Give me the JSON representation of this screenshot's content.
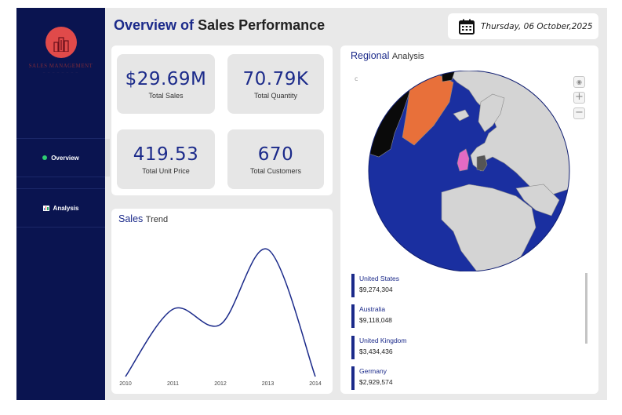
{
  "header": {
    "title_part1": "Overview of",
    "title_part2": "Sales Performance",
    "date": "Thursday, 06 October,2025"
  },
  "sidebar": {
    "logo_text": "SALES MANAGEMENT",
    "items": [
      {
        "label": "Overview",
        "icon": "green-dot-icon",
        "active": true
      },
      {
        "label": "Analysis",
        "icon": "bar-chart-icon",
        "active": false
      }
    ]
  },
  "kpis": [
    {
      "value": "$29.69M",
      "label": "Total Sales"
    },
    {
      "value": "70.79K",
      "label": "Total Quantity"
    },
    {
      "value": "419.53",
      "label": "Total Unit Price"
    },
    {
      "value": "670",
      "label": "Total Customers"
    }
  ],
  "trend": {
    "title_a": "Sales",
    "title_b": "Trend"
  },
  "chart_data": {
    "type": "line",
    "x": [
      "2010",
      "2011",
      "2012",
      "2013",
      "2014"
    ],
    "values": [
      0.0,
      0.53,
      0.41,
      1.0,
      0.0
    ],
    "title": "Sales Trend",
    "color": "#1b2a8a",
    "grid": false
  },
  "regional": {
    "title_a": "Regional",
    "title_b": "Analysis",
    "map_marker": "c",
    "controls": [
      "locate-icon",
      "zoom-in-icon",
      "zoom-out-icon"
    ],
    "items": [
      {
        "name": "United States",
        "value": "$9,274,304"
      },
      {
        "name": "Australia",
        "value": "$9,118,048"
      },
      {
        "name": "United Kingdom",
        "value": "$3,434,436"
      },
      {
        "name": "Germany",
        "value": "$2,929,574"
      }
    ]
  },
  "colors": {
    "sidebar": "#0a1450",
    "accent": "#1b2a8a",
    "logo": "#e04a4a",
    "ocean": "#1a2fa0",
    "land": "#d4d4d4",
    "greenland": "#e8703a",
    "uk": "#e36ac4"
  }
}
